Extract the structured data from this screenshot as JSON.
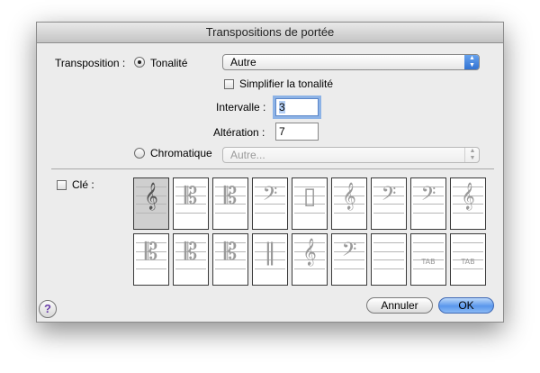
{
  "window": {
    "title": "Transpositions de portée"
  },
  "transposition": {
    "label": "Transposition :",
    "tonalite": {
      "label": "Tonalité",
      "selected": true,
      "popup_value": "Autre",
      "simplify_label": "Simplifier la tonalité",
      "simplify_checked": false,
      "intervalle_label": "Intervalle :",
      "intervalle_value": "3",
      "alteration_label": "Altération :",
      "alteration_value": "7"
    },
    "chromatique": {
      "label": "Chromatique",
      "selected": false,
      "popup_value": "Autre..."
    }
  },
  "cle": {
    "label": "Clé :",
    "checked": false,
    "clefs": [
      {
        "name": "treble-clef-icon",
        "glyph": "𝄞"
      },
      {
        "name": "alto-clef-icon",
        "glyph": "𝄡"
      },
      {
        "name": "tenor-clef-icon",
        "glyph": "𝄡"
      },
      {
        "name": "bass-clef-icon",
        "glyph": "𝄢"
      },
      {
        "name": "percussion-clef-icon",
        "glyph": "▯"
      },
      {
        "name": "treble-8vb-clef-icon",
        "glyph": "𝄞"
      },
      {
        "name": "bass-8vb-clef-icon",
        "glyph": "𝄢"
      },
      {
        "name": "bass-clef-icon",
        "glyph": "𝄢"
      },
      {
        "name": "treble-clef-icon",
        "glyph": "𝄞"
      },
      {
        "name": "soprano-clef-icon",
        "glyph": "𝄡"
      },
      {
        "name": "baritone-clef-icon",
        "glyph": "𝄡"
      },
      {
        "name": "baritone-c-clef-icon",
        "glyph": "𝄡"
      },
      {
        "name": "percussion-clef-icon",
        "glyph": "‖"
      },
      {
        "name": "treble-8va-clef-icon",
        "glyph": "𝄞"
      },
      {
        "name": "bass-8va-clef-icon",
        "glyph": "𝄢"
      },
      {
        "name": "blank-clef-icon",
        "glyph": ""
      },
      {
        "name": "tab-clef-icon",
        "glyph": "TAB"
      },
      {
        "name": "tab-small-clef-icon",
        "glyph": "TAB"
      }
    ],
    "selected_index": 0
  },
  "buttons": {
    "cancel": "Annuler",
    "ok": "OK",
    "help": "?"
  },
  "icons": {
    "popup_arrows": "up-down-arrows-icon",
    "help": "question-mark-icon"
  },
  "colors": {
    "accent": "#5a97ec",
    "window_bg": "#ececec"
  }
}
